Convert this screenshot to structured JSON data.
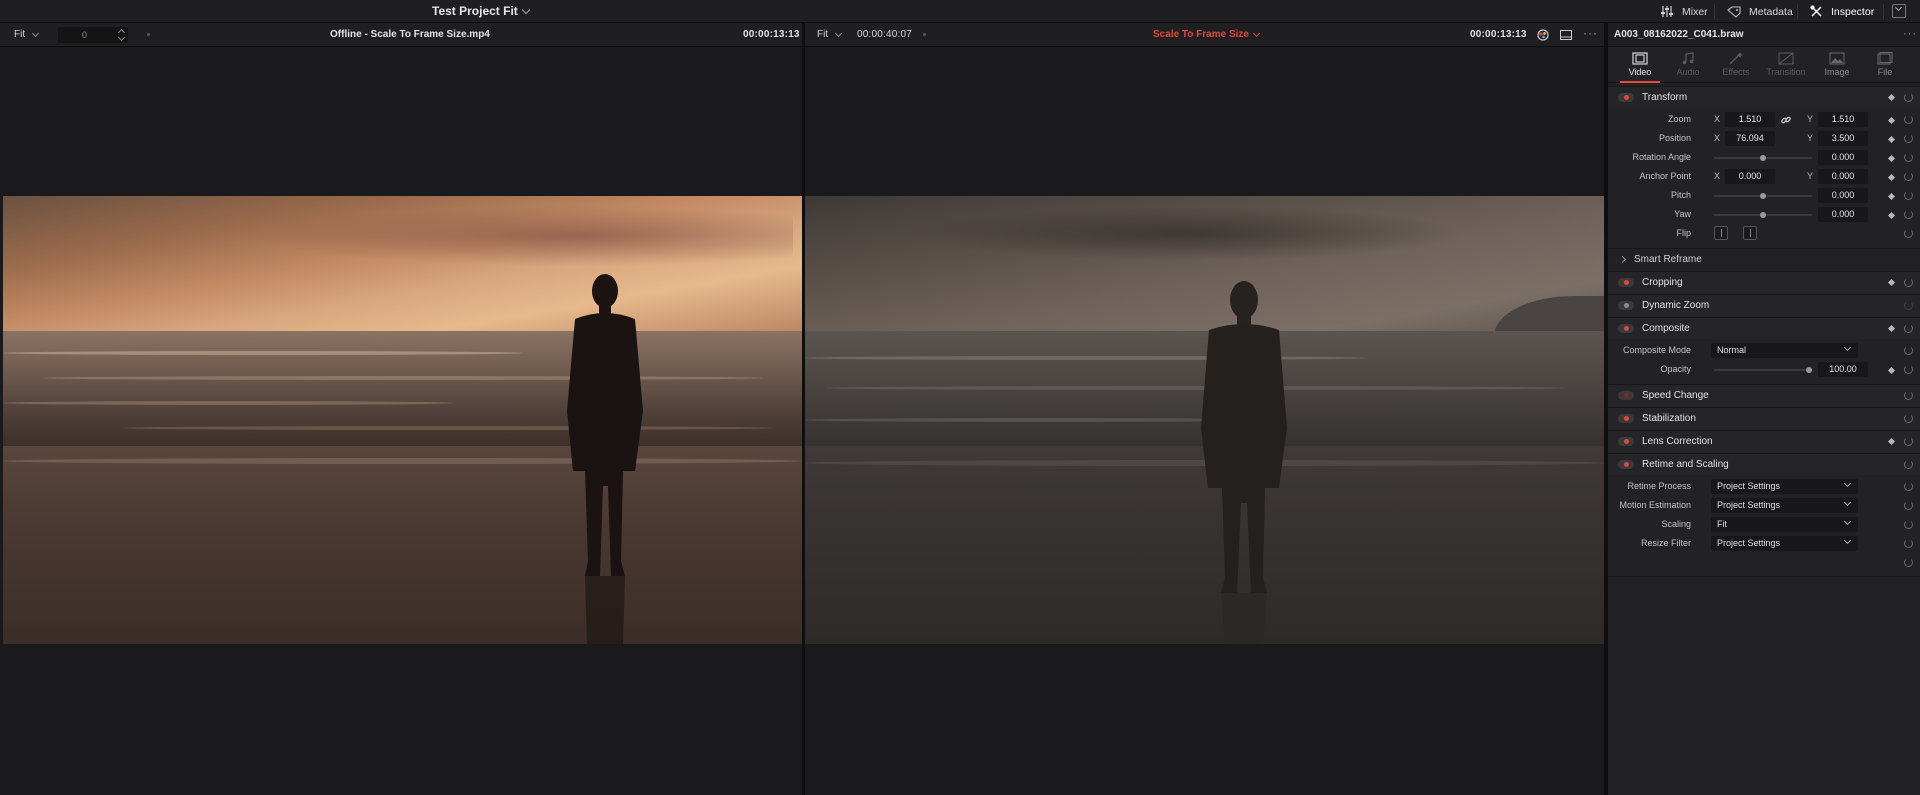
{
  "topbar": {
    "project_title": "Test Project Fit",
    "mixer": "Mixer",
    "metadata": "Metadata",
    "inspector": "Inspector"
  },
  "left_viewer": {
    "fit": "Fit",
    "zoom_value": "0",
    "clip_name": "Offline - Scale To Frame Size.mp4",
    "timecode": "00:00:13:13"
  },
  "right_viewer": {
    "fit": "Fit",
    "timecode_left": "00:00:40:07",
    "title": "Scale To Frame Size",
    "timecode": "00:00:13:13"
  },
  "inspector": {
    "clip_name": "A003_08162022_C041.braw",
    "tabs": [
      {
        "label": "Video",
        "icon": "film-icon",
        "active": true
      },
      {
        "label": "Audio",
        "icon": "music-note-icon",
        "active": false
      },
      {
        "label": "Effects",
        "icon": "effects-wand-icon",
        "active": false
      },
      {
        "label": "Transition",
        "icon": "transition-icon",
        "active": false
      },
      {
        "label": "Image",
        "icon": "image-icon",
        "active": false
      },
      {
        "label": "File",
        "icon": "file-icon",
        "active": false
      }
    ],
    "transform": {
      "title": "Transform",
      "zoom_label": "Zoom",
      "zoom_x": "1.510",
      "zoom_y": "1.510",
      "position_label": "Position",
      "position_x": "76.094",
      "position_y": "3.500",
      "rotation_label": "Rotation Angle",
      "rotation": "0.000",
      "anchor_label": "Anchor Point",
      "anchor_x": "0.000",
      "anchor_y": "0.000",
      "pitch_label": "Pitch",
      "pitch": "0.000",
      "yaw_label": "Yaw",
      "yaw": "0.000",
      "flip_label": "Flip",
      "x": "X",
      "y": "Y"
    },
    "smart_reframe": "Smart Reframe",
    "cropping": "Cropping",
    "dynamic_zoom": "Dynamic Zoom",
    "composite": {
      "title": "Composite",
      "mode_label": "Composite Mode",
      "mode": "Normal",
      "opacity_label": "Opacity",
      "opacity": "100.00"
    },
    "speed_change": "Speed Change",
    "stabilization": "Stabilization",
    "lens_correction": "Lens Correction",
    "retime": {
      "title": "Retime and Scaling",
      "process_label": "Retime Process",
      "process": "Project Settings",
      "motion_label": "Motion Estimation",
      "motion": "Project Settings",
      "scaling_label": "Scaling",
      "scaling": "Fit",
      "resize_label": "Resize Filter",
      "resize": "Project Settings"
    }
  },
  "colors": {
    "accent_red": "#e0473d",
    "panel": "#222224",
    "background": "#1a1a1c"
  }
}
